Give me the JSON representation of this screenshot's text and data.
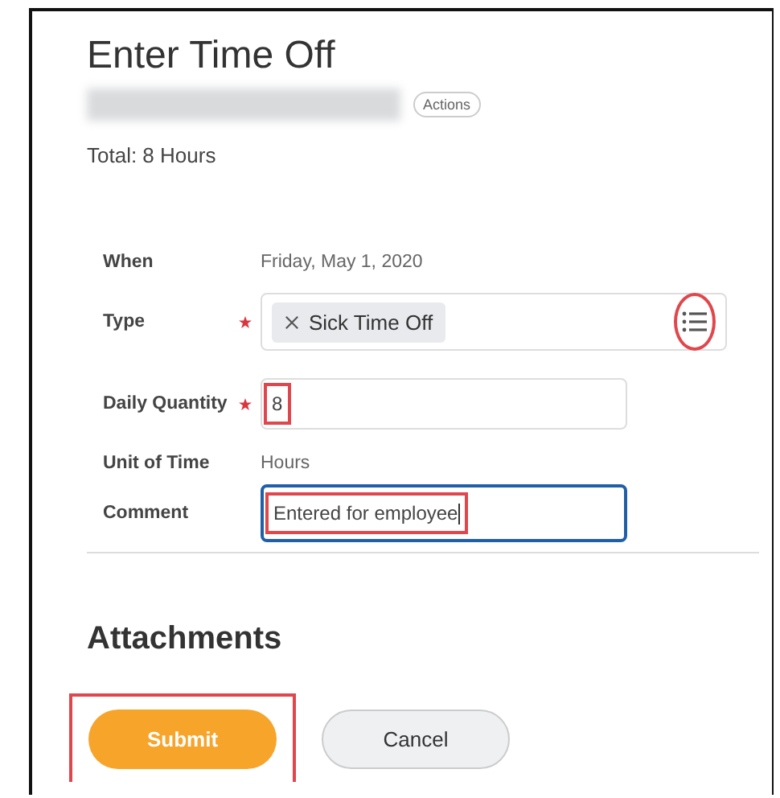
{
  "title": "Enter Time Off",
  "actions_button": "Actions",
  "total": "Total: 8 Hours",
  "fields": [
    {
      "label": "When",
      "kind": "static",
      "required": false,
      "value": "Friday, May 1, 2020"
    },
    {
      "label": "Type",
      "kind": "select",
      "required": true,
      "tags": [
        "Sick Time Off"
      ],
      "highlighted": true
    },
    {
      "label": "Daily Quantity",
      "kind": "input",
      "required": true,
      "value": "8",
      "focused": false,
      "highlighted": true
    },
    {
      "label": "Unit of Time",
      "kind": "static",
      "required": false,
      "value": "Hours"
    },
    {
      "label": "Comment",
      "kind": "input",
      "required": false,
      "value": "Entered for employee",
      "focused": true,
      "highlighted": true
    }
  ],
  "attachments_heading": "Attachments",
  "buttons": [
    {
      "label": "Submit",
      "kind": "primary",
      "highlighted": true
    },
    {
      "label": "Cancel",
      "kind": "secondary",
      "highlighted": false
    }
  ]
}
